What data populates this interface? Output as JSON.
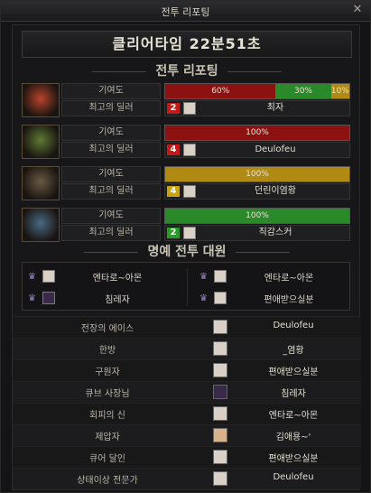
{
  "window": {
    "title": "전투 리포팅",
    "close_icon": "close-icon"
  },
  "clear_time": "클리어타임  22분51초",
  "report_title": "전투 리포팅",
  "labels": {
    "contribution": "기여도",
    "best_dealer": "최고의 딜러"
  },
  "players": [
    {
      "portrait_color": "#b8442b",
      "segments": [
        {
          "label": "60%",
          "value": 60,
          "color": "#8c1212"
        },
        {
          "label": "30%",
          "value": 30,
          "color": "#2a8a2a"
        },
        {
          "label": "10%",
          "value": 10,
          "color": "#b08a12"
        }
      ],
      "rank": "2",
      "rank_color": "#c21a1a",
      "dealer": "최자"
    },
    {
      "portrait_color": "#5f7a34",
      "segments": [
        {
          "label": "100%",
          "value": 100,
          "color": "#8c1212"
        }
      ],
      "rank": "4",
      "rank_color": "#c21a1a",
      "dealer": "Deulofeu"
    },
    {
      "portrait_color": "#6a5a45",
      "segments": [
        {
          "label": "100%",
          "value": 100,
          "color": "#b08a12"
        }
      ],
      "rank": "4",
      "rank_color": "#c9a412",
      "dealer": "던린이염황"
    },
    {
      "portrait_color": "#4a6a84",
      "segments": [
        {
          "label": "100%",
          "value": 100,
          "color": "#2a8a2a"
        }
      ],
      "rank": "2",
      "rank_color": "#2a9a2a",
      "dealer": "직감스커"
    }
  ],
  "honor_title": "명예 전투 대원",
  "honor": [
    {
      "name": "엔타로~아몬"
    },
    {
      "name": "엔타로~아몬"
    },
    {
      "name": "침레자"
    },
    {
      "name": "편애받으실분"
    }
  ],
  "awards": [
    {
      "title": "전장의 에이스",
      "who": "Deulofeu"
    },
    {
      "title": "한방",
      "who": "_염황"
    },
    {
      "title": "구원자",
      "who": "편애받으실분"
    },
    {
      "title": "큐브 사장님",
      "who": "침레자"
    },
    {
      "title": "회피의 신",
      "who": "엔타로~아몬"
    },
    {
      "title": "제압자",
      "who": "김애용~'"
    },
    {
      "title": "큐어 달인",
      "who": "편애받으실분"
    },
    {
      "title": "상태이상 전문가",
      "who": "Deulofeu"
    }
  ]
}
